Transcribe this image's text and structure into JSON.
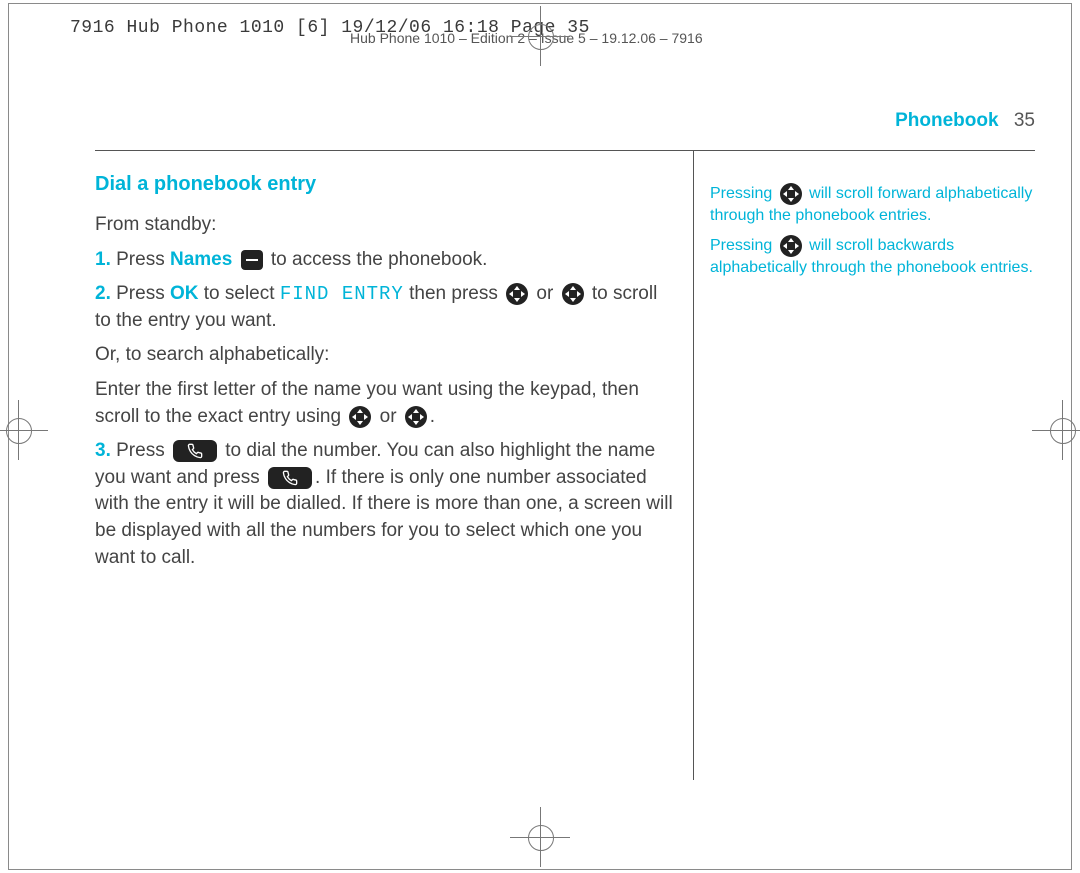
{
  "meta": {
    "print_header": "7916 Hub Phone 1010 [6]  19/12/06  16:18  Page 35",
    "running_header": "Hub Phone 1010 – Edition 2 – Issue 5 – 19.12.06 – 7916"
  },
  "section": {
    "name": "Phonebook",
    "page": "35"
  },
  "main": {
    "heading": "Dial a phonebook entry",
    "intro": "From standby:",
    "step1_num": "1.",
    "step1_a": " Press ",
    "step1_kw": "Names",
    "step1_b": " to access the phonebook.",
    "step2_num": "2.",
    "step2_a": " Press ",
    "step2_kw": "OK",
    "step2_b": " to select ",
    "step2_lcd": "FIND ENTRY",
    "step2_c": " then press ",
    "step2_or": " or ",
    "step2_d": " to scroll to the entry you want.",
    "alt_intro": "Or, to search alphabetically:",
    "alt_a": "Enter the first letter of the name you want using the keypad, then scroll to the exact entry using ",
    "alt_or": " or ",
    "alt_b": ".",
    "step3_num": "3.",
    "step3_a": " Press ",
    "step3_b": " to dial the number. You can also highlight the name you want and press ",
    "step3_c": ". If there is only one number associated with the entry it will be dialled. If there is more than one, a screen will be displayed with all the numbers for you to select which one you want to call."
  },
  "side": {
    "n1a": "Pressing ",
    "n1b": " will scroll forward alphabetically through the phonebook entries.",
    "n2a": "Pressing ",
    "n2b": " will scroll backwards alphabetically through the phonebook entries."
  }
}
